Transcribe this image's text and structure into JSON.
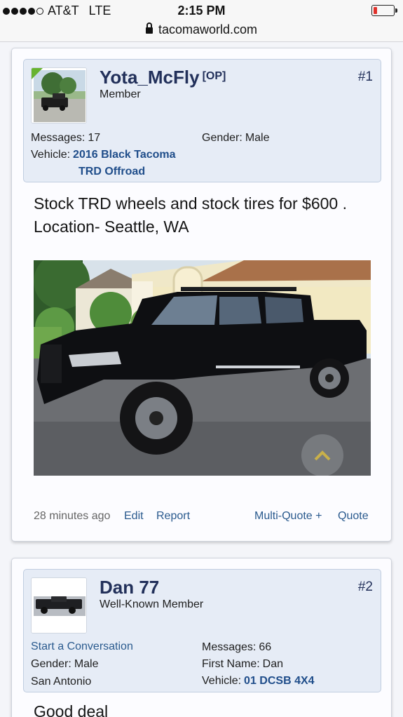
{
  "status_bar": {
    "carrier": "AT&T",
    "network": "LTE",
    "time": "2:15 PM",
    "signal_bars": 4,
    "battery_level": 0.18
  },
  "browser": {
    "url": "tacomaworld.com"
  },
  "posts": [
    {
      "username": "Yota_McFly",
      "op_tag": "[OP]",
      "user_title": "Member",
      "post_number": "#1",
      "messages_label": "Messages:",
      "messages": "17",
      "gender_label": "Gender:",
      "gender": "Male",
      "vehicle_label": "Vehicle:",
      "vehicle_line1": "2016 Black Tacoma",
      "vehicle_line2": "TRD Offroad",
      "body": "Stock TRD wheels and stock tires for $600 . Location- Seattle, WA",
      "posted": "28 minutes ago",
      "actions": {
        "edit": "Edit",
        "report": "Report",
        "multi_quote": "Multi-Quote +",
        "quote": "Quote"
      }
    },
    {
      "username": "Dan 77",
      "user_title": "Well-Known Member",
      "post_number": "#2",
      "start_conversation": "Start a Conversation",
      "gender_label": "Gender:",
      "gender": "Male",
      "location": "San Antonio",
      "messages_label": "Messages:",
      "messages": "66",
      "first_name_label": "First Name:",
      "first_name": "Dan",
      "vehicle_label": "Vehicle:",
      "vehicle": "01 DCSB 4X4",
      "body": "Good deal"
    }
  ],
  "colors": {
    "username": "#22305a",
    "link": "#2a5a8e",
    "userinfo_bg": "#e6ecf6",
    "online": "#67b32f"
  }
}
